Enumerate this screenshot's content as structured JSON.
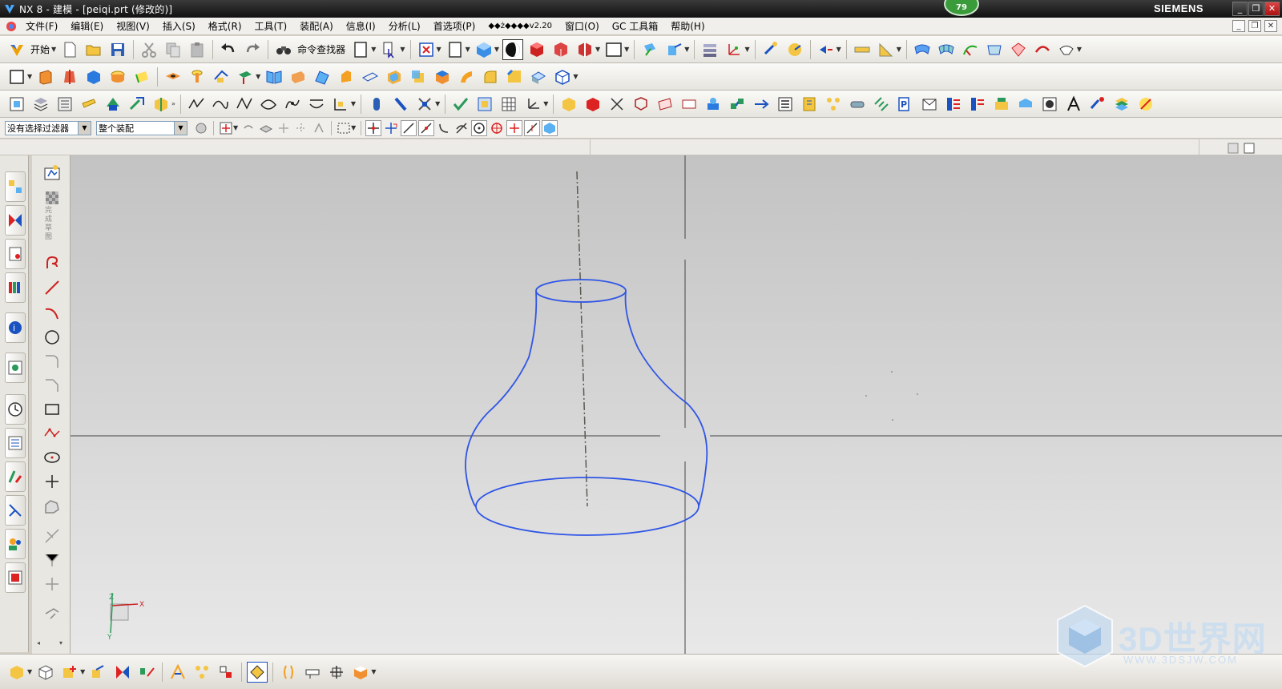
{
  "window": {
    "title": "NX 8 - 建模 - [peiqi.prt (修改的)]",
    "brand": "SIEMENS",
    "badge_count": "79"
  },
  "menubar": {
    "items": [
      "文件(F)",
      "编辑(E)",
      "视图(V)",
      "插入(S)",
      "格式(R)",
      "工具(T)",
      "装配(A)",
      "信息(I)",
      "分析(L)",
      "首选项(P)",
      "◆◆ż◆◆◆◆v2.20",
      "窗口(O)",
      "GC 工具箱",
      "帮助(H)"
    ]
  },
  "toolbar1": {
    "start_label": "开始",
    "command_finder_label": "命令查找器"
  },
  "selection_bar": {
    "filter_value": "没有选择过滤器",
    "scope_value": "整个装配"
  },
  "sketch_panel": {
    "finish_label": "完成草图"
  },
  "watermark": {
    "text": "3D世界网",
    "subtext": "WWW.3DSJW.COM"
  },
  "triad": {
    "z": "Z",
    "x": "X",
    "y": "Y"
  },
  "colors": {
    "curve": "#2f55e6",
    "axis": "#5a5a50",
    "titlebar": "#1c1c1c",
    "graphics_bg_top": "#c3c3c3",
    "graphics_bg_bottom": "#e8e8e8"
  }
}
